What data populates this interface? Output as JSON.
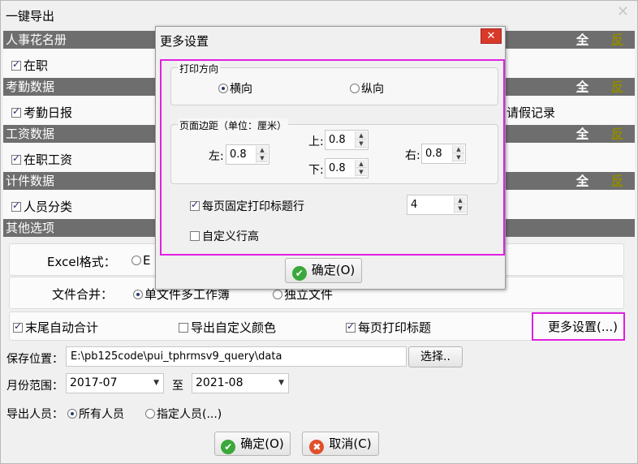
{
  "window": {
    "title": "一键导出",
    "close_glyph": "✕"
  },
  "sections": {
    "roster": {
      "title": "人事花名册",
      "all": "全",
      "rev": "反",
      "item": "在职"
    },
    "attendance": {
      "title": "考勤数据",
      "all": "全",
      "rev": "反",
      "item": "考勤日报",
      "item2_partial": "请假记录"
    },
    "salary": {
      "title": "工资数据",
      "all": "全",
      "rev": "反",
      "item": "在职工资"
    },
    "piecework": {
      "title": "计件数据",
      "all": "全",
      "rev": "反",
      "item": "人员分类"
    },
    "other": {
      "title": "其他选项"
    }
  },
  "other_options": {
    "excel_format_label": "Excel格式：",
    "excel_format_option_partial": "E",
    "file_merge_label": "文件合并：",
    "file_merge_option1_partial": "单文件多工作簿",
    "file_merge_option2_partial": "独立文件",
    "auto_total": "末尾自动合计",
    "export_custom_color": "导出自定义颜色",
    "print_title_each_page": "每页打印标题",
    "more_settings_button": "更多设置(...)"
  },
  "save": {
    "label": "保存位置：",
    "path": "E:\\pb125code\\pui_tphrmsv9_query\\data",
    "choose_button": "选择.."
  },
  "month_range": {
    "label": "月份范围：",
    "from": "2017-07",
    "to_label": "至",
    "to": "2021-08"
  },
  "export_people": {
    "label": "导出人员：",
    "option_all": "所有人员",
    "option_specified": "指定人员(...)"
  },
  "footer": {
    "ok": "确定(O)",
    "cancel": "取消(C)"
  },
  "dialog": {
    "title": "更多设置",
    "close_glyph": "✕",
    "orientation_group": "打印方向",
    "landscape": "横向",
    "portrait": "纵向",
    "margins_group": "页面边距（单位：厘米）",
    "left_label": "左:",
    "left_value": "0.8",
    "top_label": "上:",
    "top_value": "0.8",
    "bottom_label": "下:",
    "bottom_value": "0.8",
    "right_label": "右:",
    "right_value": "0.8",
    "fixed_title_rows": "每页固定打印标题行",
    "fixed_title_rows_value": "4",
    "custom_row_height": "自定义行高",
    "ok": "确定(O)"
  },
  "colors": {
    "section_header": "#6e6e6e",
    "highlight": "#e020e0",
    "rev_link": "#8f8a00",
    "close_red": "#d83a2a"
  },
  "icons": {
    "ok": "check-circle-icon",
    "cancel": "x-circle-icon"
  }
}
